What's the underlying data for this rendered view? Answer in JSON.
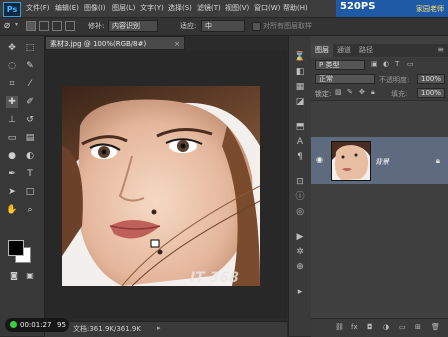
{
  "app": {
    "logo": "Ps"
  },
  "menu": [
    "文件(F)",
    "编辑(E)",
    "图像(I)",
    "图层(L)",
    "文字(Y)",
    "选择(S)",
    "滤镜(T)",
    "视图(V)",
    "窗口(W)",
    "帮助(H)"
  ],
  "brand": {
    "big": "520PS",
    "small": "家园老师"
  },
  "options": {
    "repair_label": "修补:",
    "repair_value": "内容识别",
    "adapt_label": "适应:",
    "adapt_value": "中",
    "checkbox_label": "对所有图层取样"
  },
  "document": {
    "tab_title": "素材3.jpg @ 100%(RGB/8#)",
    "status": "文档:361.9K/361.9K",
    "watermark": "IT 368"
  },
  "timer": {
    "time": "00:01:27",
    "count": "95"
  },
  "panel": {
    "tabs": [
      "图层",
      "通道",
      "路径"
    ],
    "kind_label": "P 类型",
    "blend_mode": "正常",
    "opacity_label": "不透明度:",
    "opacity_value": "100%",
    "lock_label": "锁定:",
    "fill_label": "填充:",
    "fill_value": "100%",
    "layer_name": "背景"
  },
  "colors": {
    "accent": "#3fa0e0",
    "brand_bg": "#1e5aa5",
    "selected_layer": "#5e6b7f"
  },
  "icons": {
    "toolbar": [
      "move-icon",
      "marquee-icon",
      "lasso-icon",
      "quick-select-icon",
      "crop-icon",
      "eyedropper-icon",
      "healing-brush-icon",
      "brush-icon",
      "stamp-icon",
      "history-brush-icon",
      "eraser-icon",
      "gradient-icon",
      "blur-icon",
      "dodge-icon",
      "pen-icon",
      "type-icon",
      "path-select-icon",
      "shape-icon",
      "hand-icon",
      "zoom-icon"
    ],
    "strip": [
      "history-icon",
      "color-icon",
      "swatches-icon",
      "styles-icon",
      "adjust-icon",
      "character-icon",
      "paragraph-icon",
      "layer-comp-icon",
      "info-icon",
      "navigator-icon",
      "actions-icon",
      "brush-preset-icon",
      "clone-source-icon",
      "tool-preset-icon"
    ]
  }
}
